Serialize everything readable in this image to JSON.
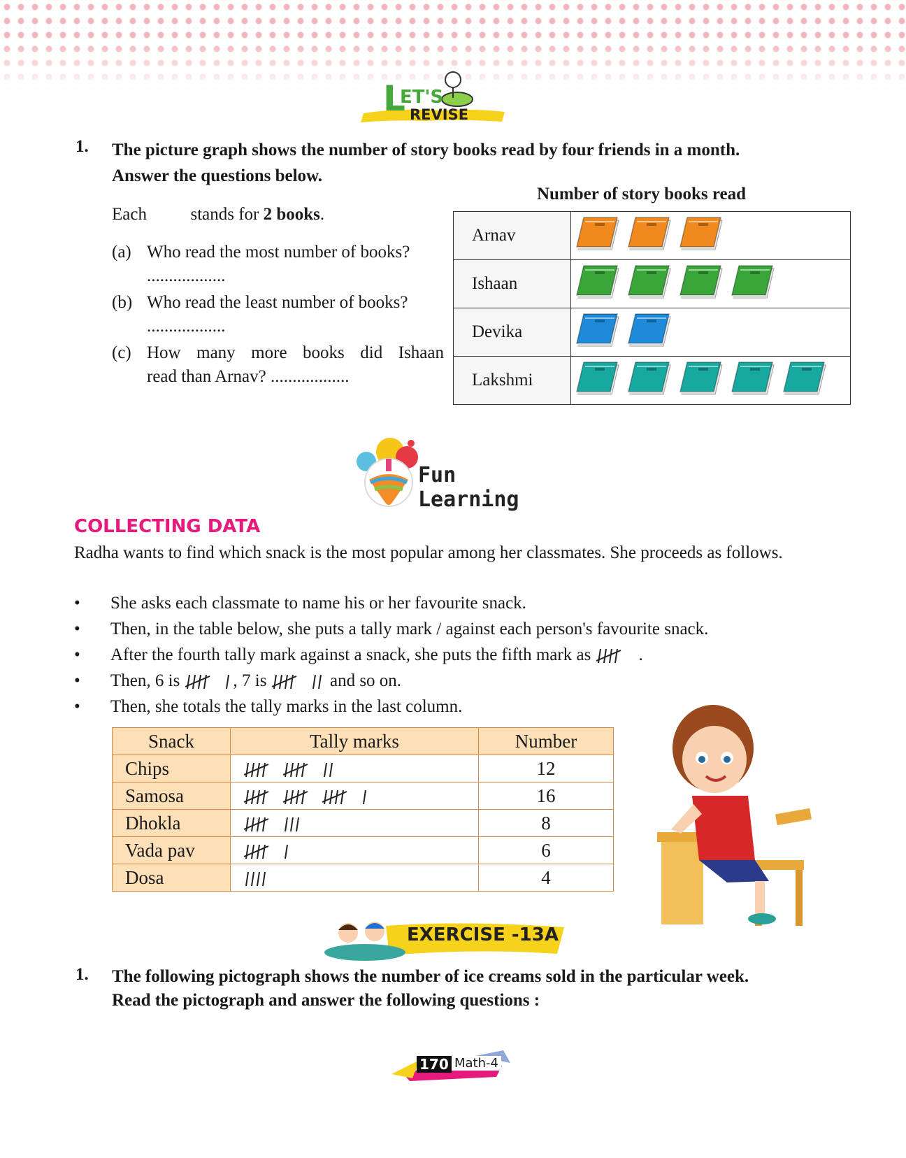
{
  "header": {
    "lets_revise_top": "ET'S",
    "lets_revise_letter": "L",
    "lets_revise_bottom": "REVISE"
  },
  "question1": {
    "number": "1.",
    "text_line1": "The picture graph shows the number of story books read by four friends in a month.",
    "text_line2": "Answer the questions below.",
    "key_prefix": "Each",
    "key_suffix": "stands for",
    "key_value": "2 books",
    "key_end": ".",
    "sub_questions": [
      {
        "label": "(a)",
        "text": "Who read the most number of books?",
        "blank": ".................."
      },
      {
        "label": "(b)",
        "text": "Who read the least number of books?",
        "blank": ".................."
      },
      {
        "label": "(c)",
        "text_line1": "How many more books did Ishaan",
        "text_line2": "read than Arnav? .................."
      }
    ]
  },
  "chart_data": {
    "type": "table",
    "title": "Number of story books read",
    "rows": [
      {
        "name": "Arnav",
        "symbols": 3,
        "color": "#f08a1e"
      },
      {
        "name": "Ishaan",
        "symbols": 4,
        "color": "#3aa63a"
      },
      {
        "name": "Devika",
        "symbols": 2,
        "color": "#1e8ad8"
      },
      {
        "name": "Lakshmi",
        "symbols": 5,
        "color": "#17a8a0"
      }
    ],
    "symbol_value": 2
  },
  "fun_learning": {
    "title": "Fun Learning"
  },
  "collecting": {
    "heading": "COLLECTING DATA",
    "intro": "Radha wants to find which snack is the most popular among her classmates. She proceeds as follows.",
    "bullets": [
      "She asks each classmate to name his or her favourite snack.",
      "Then, in the table below, she puts a tally mark / against each person's favourite snack.",
      "After the fourth tally mark against a snack, she puts the fifth mark as",
      "Then, 6 is",
      "Then, she totals the tally marks in the last column."
    ],
    "bullet3_end": ".",
    "bullet4_mid": ", 7 is",
    "bullet4_end": "and so on.",
    "bullet_symbol": "•"
  },
  "tally_table": {
    "headers": [
      "Snack",
      "Tally marks",
      "Number"
    ],
    "rows": [
      {
        "snack": "Chips",
        "count": 12,
        "number": "12"
      },
      {
        "snack": "Samosa",
        "count": 16,
        "number": "16"
      },
      {
        "snack": "Dhokla",
        "count": 8,
        "number": "8"
      },
      {
        "snack": "Vada pav",
        "count": 6,
        "number": "6"
      },
      {
        "snack": "Dosa",
        "count": 4,
        "number": "4"
      }
    ]
  },
  "exercise": {
    "banner": "EXERCISE -13A",
    "number": "1.",
    "text_line1": "The following pictograph shows the number of ice creams sold in the particular week.",
    "text_line2": "Read the pictograph and answer the following questions :"
  },
  "footer": {
    "page_number": "170",
    "book": "Math-4"
  }
}
